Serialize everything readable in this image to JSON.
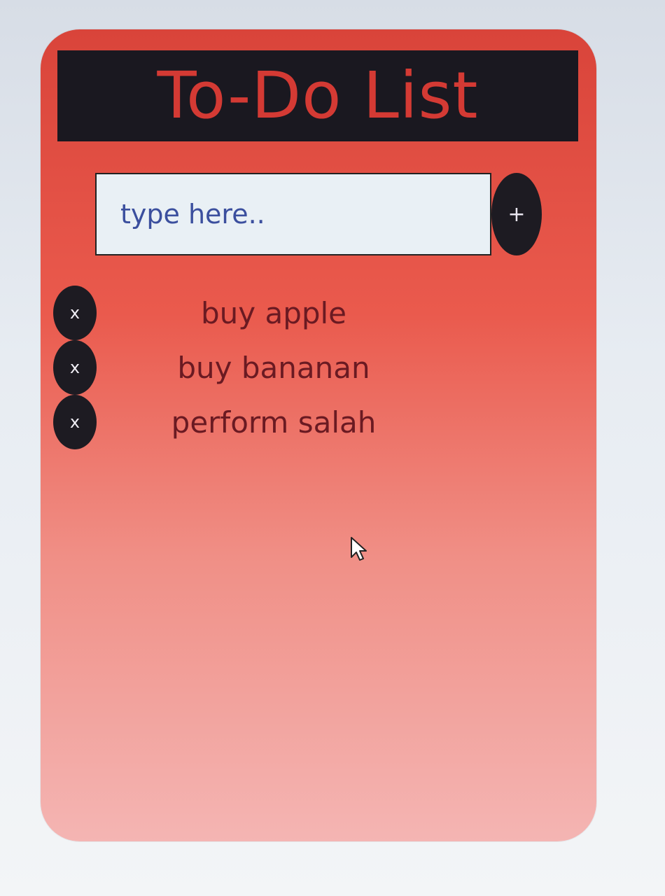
{
  "app": {
    "title": "To-Do List"
  },
  "input": {
    "placeholder": "type here..",
    "value": ""
  },
  "add_button": {
    "label": "+"
  },
  "todos": [
    {
      "text": "buy apple",
      "delete_label": "x"
    },
    {
      "text": "buy bananan",
      "delete_label": "x"
    },
    {
      "text": "perform salah",
      "delete_label": "x"
    }
  ],
  "colors": {
    "card_top": "#d9443a",
    "card_bottom": "#f4b5b3",
    "header_bg": "#1a1820",
    "title_text": "#d43a34",
    "button_bg": "#1d1b22",
    "item_text": "#6a1a22",
    "input_bg": "#e9f0f5"
  },
  "icons": {
    "add": "plus-icon",
    "delete": "close-icon",
    "cursor": "mouse-pointer-icon"
  }
}
